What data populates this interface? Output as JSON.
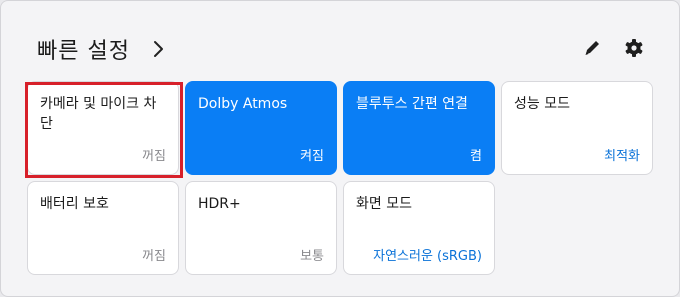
{
  "panel": {
    "title": "빠른 설정",
    "icons": {
      "expand": "chevron-right-icon",
      "edit": "pencil-icon",
      "settings": "gear-icon"
    }
  },
  "tiles": [
    {
      "label": "카메라 및 마이크 차단",
      "status": "꺼짐",
      "on": false,
      "highlighted": true
    },
    {
      "label": "Dolby Atmos",
      "status": "켜짐",
      "on": true
    },
    {
      "label": "블루투스 간편 연결",
      "status": "켬",
      "on": true
    },
    {
      "label": "성능 모드",
      "status": "최적화",
      "on": false,
      "accent": true
    },
    {
      "label": "배터리 보호",
      "status": "꺼짐",
      "on": false
    },
    {
      "label": "HDR+",
      "status": "보통",
      "on": false
    },
    {
      "label": "화면 모드",
      "status": "자연스러운 (sRGB)",
      "on": false,
      "accent": true
    }
  ],
  "colors": {
    "accent": "#0a7ef5",
    "accent_text": "#0a72d8",
    "highlight": "#d7202a"
  }
}
